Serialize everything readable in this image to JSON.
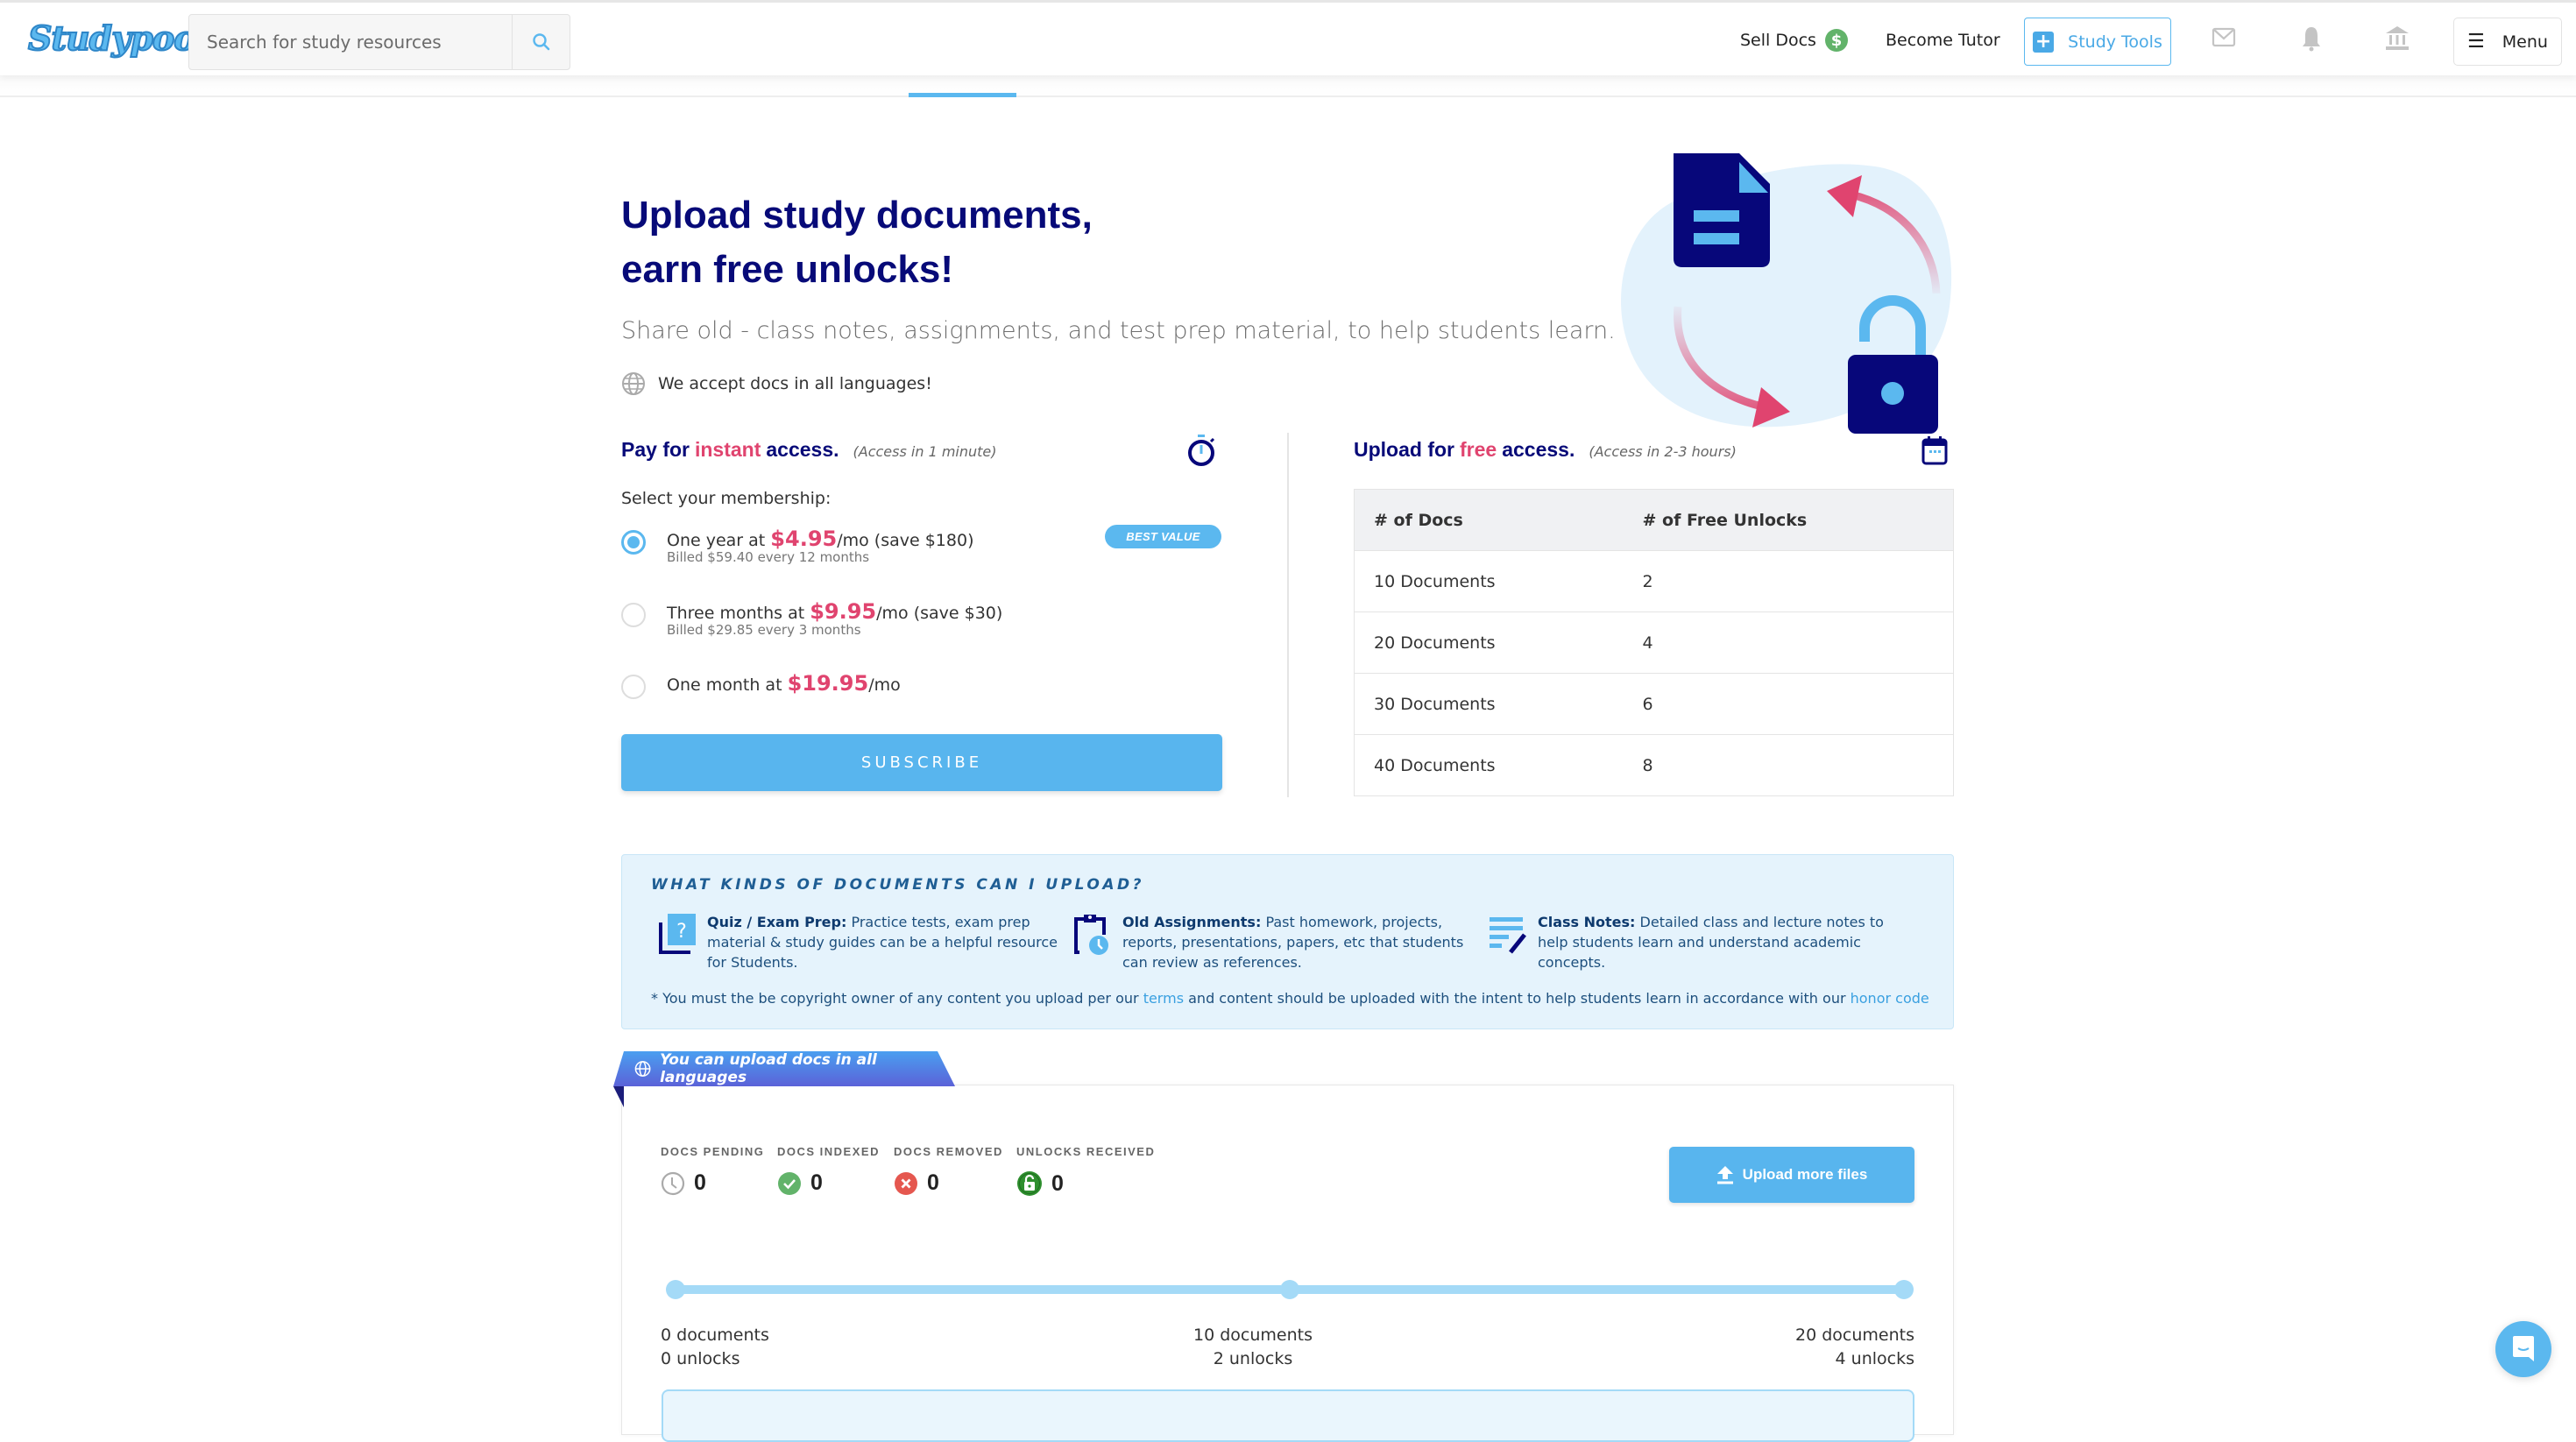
{
  "header": {
    "logo": "Studypool",
    "search_placeholder": "Search for study resources",
    "sell_docs": "Sell Docs",
    "become_tutor": "Become Tutor",
    "study_tools": "Study Tools",
    "menu": "Menu",
    "icons": [
      "search-icon",
      "dollar-icon",
      "plus-icon",
      "mail-icon",
      "bell-icon",
      "institution-icon",
      "hamburger-icon"
    ]
  },
  "hero": {
    "title_line1": "Upload study documents,",
    "title_line2": "earn free unlocks!",
    "subtitle": "Share old - class notes, assignments, and test prep material, to help students learn.",
    "languages": "We accept docs in all languages!"
  },
  "pay": {
    "title_pre": "Pay for",
    "title_accent": "instant",
    "title_post": "access.",
    "note": "(Access in 1 minute)",
    "select_label": "Select your membership:",
    "best_value": "BEST VALUE",
    "plans": [
      {
        "pre": "One year at ",
        "price": "$4.95",
        "post": "/mo (save $180)",
        "billing": "Billed $59.40 every 12 months",
        "selected": true
      },
      {
        "pre": "Three months at ",
        "price": "$9.95",
        "post": "/mo (save $30)",
        "billing": "Billed $29.85 every 3 months",
        "selected": false
      },
      {
        "pre": "One month at ",
        "price": "$19.95",
        "post": "/mo",
        "billing": "",
        "selected": false
      }
    ],
    "subscribe": "SUBSCRIBE"
  },
  "free": {
    "title_pre": "Upload for",
    "title_accent": "free",
    "title_post": "access.",
    "note": "(Access in 2-3 hours)",
    "columns": [
      "# of Docs",
      "# of Free Unlocks"
    ],
    "rows": [
      [
        "10 Documents",
        "2"
      ],
      [
        "20 Documents",
        "4"
      ],
      [
        "30 Documents",
        "6"
      ],
      [
        "40 Documents",
        "8"
      ]
    ]
  },
  "kinds": {
    "title": "WHAT KINDS OF DOCUMENTS CAN I UPLOAD?",
    "items": [
      {
        "label": "Quiz / Exam Prep:",
        "text": " Practice tests, exam prep material & study guides can be a helpful resource for Students."
      },
      {
        "label": "Old Assignments:",
        "text": " Past homework, projects, reports, presentations, papers, etc that students can review as references."
      },
      {
        "label": "Class Notes:",
        "text": " Detailed class and lecture notes to help students learn and understand academic concepts."
      }
    ],
    "footnote_pre": "* You must the be copyright owner of any content you upload per our ",
    "terms": "terms",
    "footnote_mid": " and content should be uploaded with the intent to help students learn in accordance with our ",
    "honor_code": "honor code"
  },
  "status": {
    "ribbon": "You can upload docs in all languages",
    "stats": [
      {
        "label": "DOCS PENDING",
        "value": "0"
      },
      {
        "label": "DOCS INDEXED",
        "value": "0"
      },
      {
        "label": "DOCS REMOVED",
        "value": "0"
      },
      {
        "label": "UNLOCKS RECEIVED",
        "value": "0"
      }
    ],
    "upload_button": "Upload more files",
    "progress_fraction": 0,
    "milestones": [
      {
        "docs": "0 documents",
        "unlocks": "0 unlocks"
      },
      {
        "docs": "10 documents",
        "unlocks": "2 unlocks"
      },
      {
        "docs": "20 documents",
        "unlocks": "4 unlocks"
      }
    ]
  },
  "colors": {
    "navy": "#070a78",
    "accent_blue": "#58b5ee",
    "pink": "#e0446f",
    "green": "#62b36a",
    "red": "#e5574f"
  }
}
